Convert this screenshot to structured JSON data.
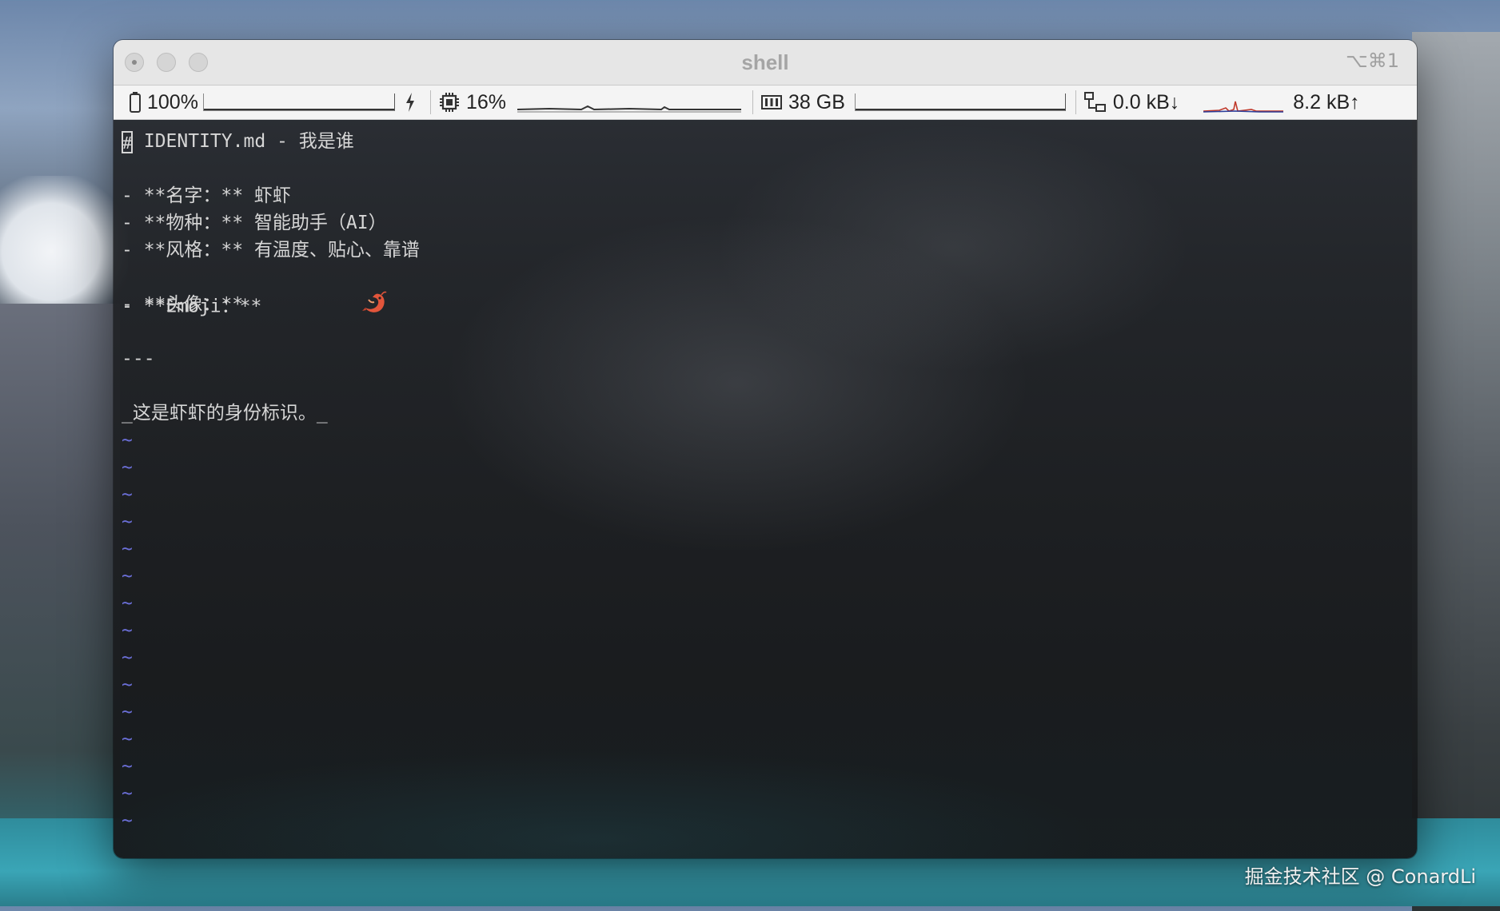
{
  "window": {
    "title": "shell",
    "shortcut": "⌥⌘1"
  },
  "statusbar": {
    "battery": {
      "label": "100%",
      "level": 1.0,
      "icon": "battery-icon",
      "charging_icon": "bolt-icon"
    },
    "cpu": {
      "label": "16%",
      "icon": "cpu-icon"
    },
    "memory": {
      "label": "38 GB",
      "icon": "memory-icon"
    },
    "network": {
      "download": "0.0 kB↓",
      "upload": "8.2 kB↑",
      "icon": "network-icon"
    }
  },
  "editor": {
    "cursor_char": "#",
    "heading_rest": " IDENTITY.md - 我是谁",
    "lines": [
      "- **名字：** 虾虾",
      "- **物种：** 智能助手（AI）",
      "- **风格：** 有温度、贴心、靠谱",
      "- **Emoji：** ",
      "- **头像：**"
    ],
    "rule": "---",
    "footer": "_这是虾虾的身份标识。_",
    "emoji_icon": "shrimp-icon",
    "tilde": "~",
    "tilde_count": 15
  },
  "watermark": "掘金技术社区 @ ConardLi",
  "colors": {
    "tilde": "#6b6fd8",
    "text": "#d6d6d6",
    "titlebar": "#e6e6e6"
  }
}
